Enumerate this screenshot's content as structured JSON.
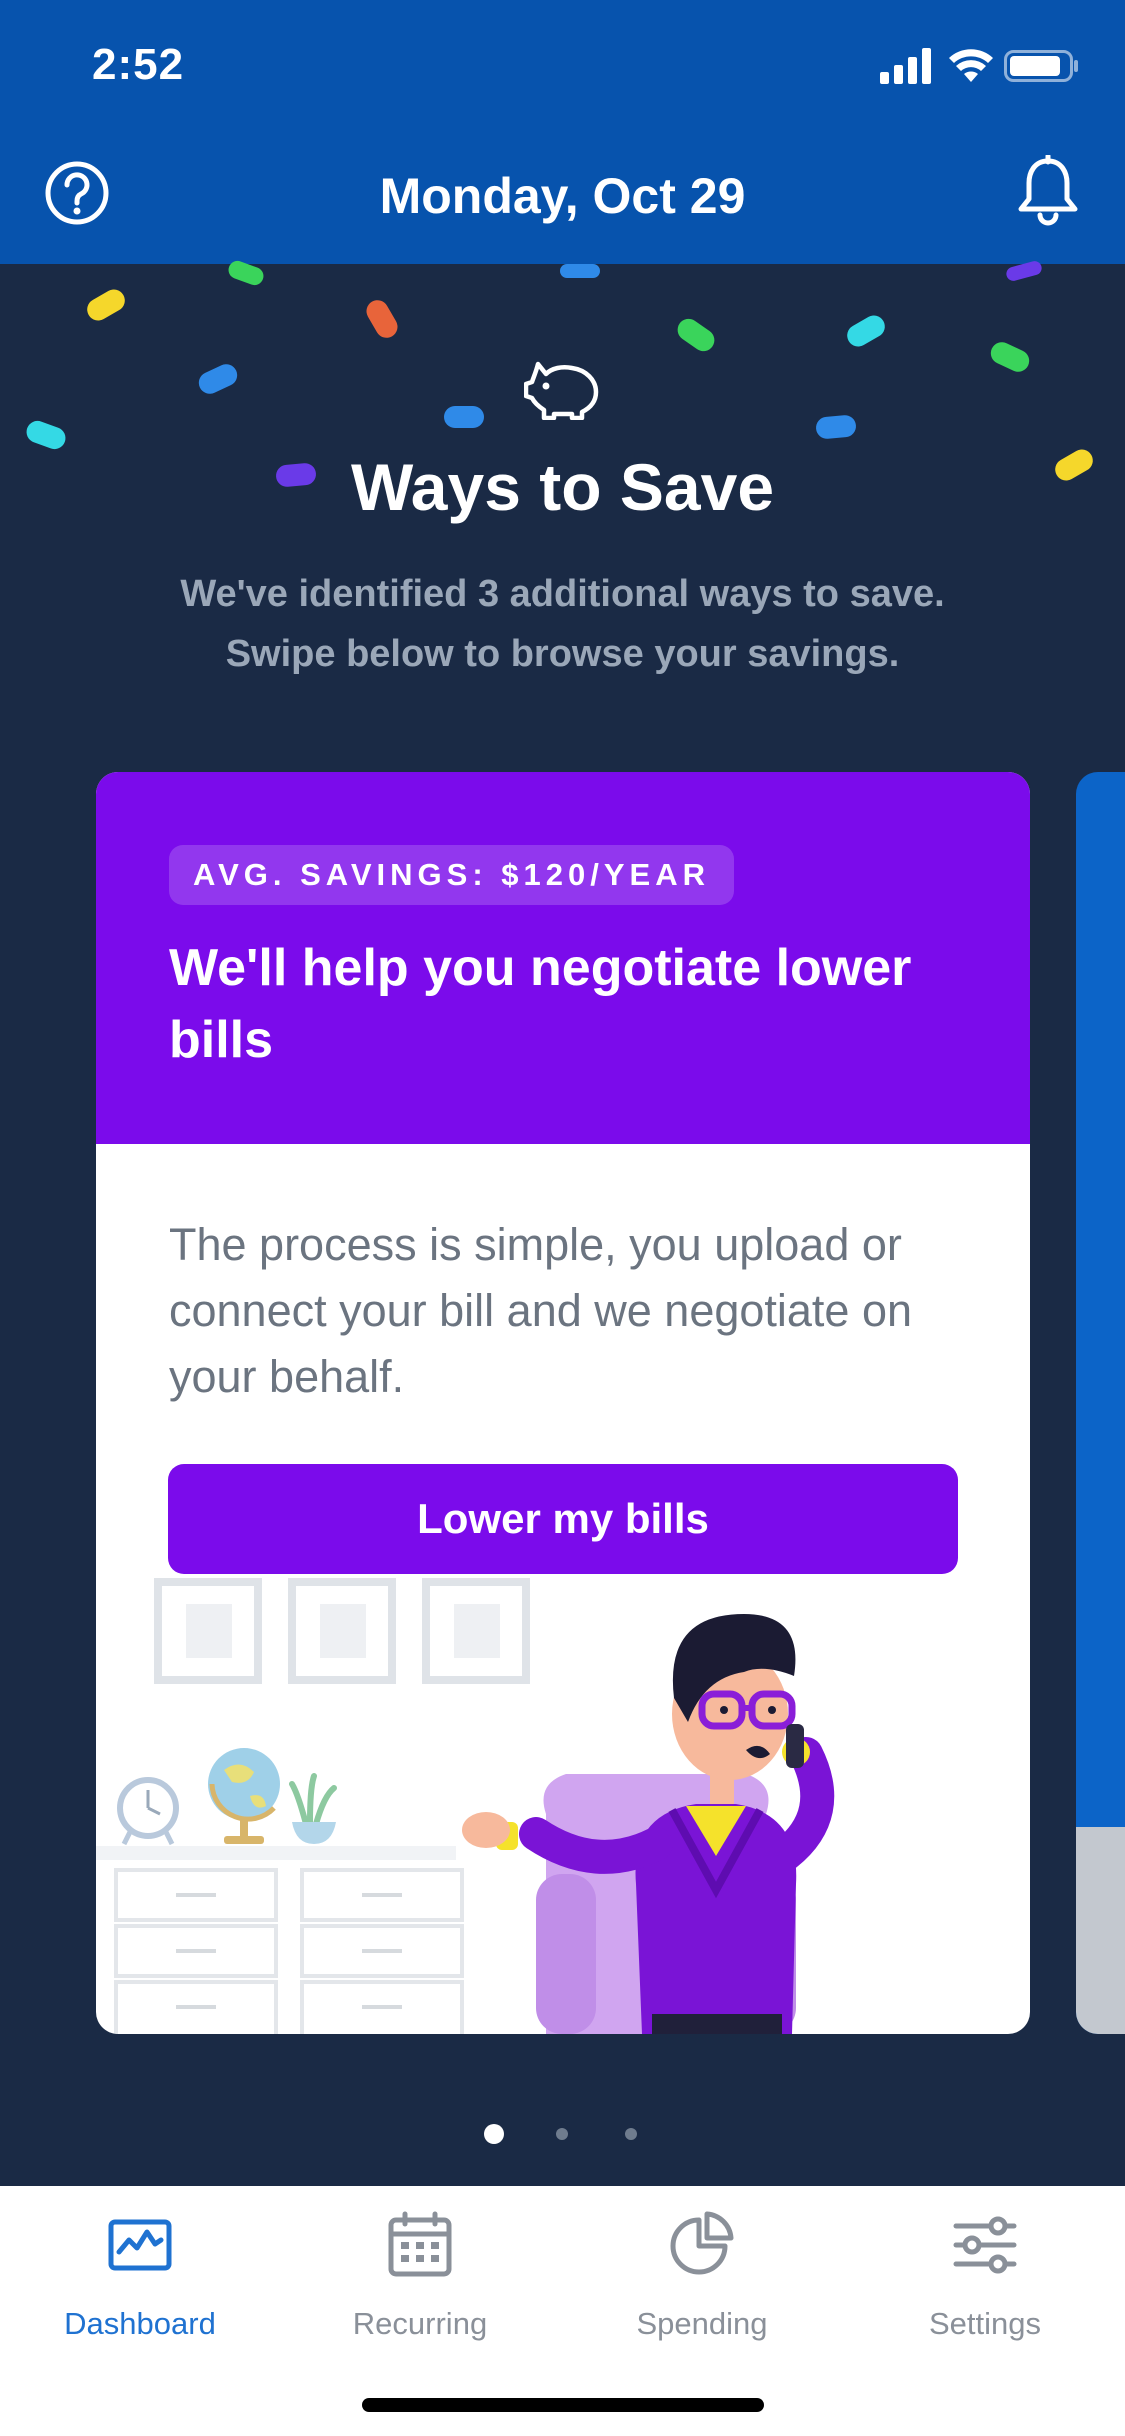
{
  "status_bar": {
    "time": "2:52"
  },
  "header": {
    "title": "Monday, Oct 29",
    "help_icon": "help-circle-icon",
    "bell_icon": "bell-icon",
    "background": "#0753ad"
  },
  "hero": {
    "icon": "piggy-bank-icon",
    "title": "Ways to Save",
    "subtitle_line1": "We've identified 3 additional ways to save.",
    "subtitle_line2": "Swipe below to browse your savings."
  },
  "card": {
    "badge": "AVG. SAVINGS: $120/YEAR",
    "title": "We'll help you negotiate lower bills",
    "description": "The process is simple, you upload or connect your bill and we negotiate on your behalf.",
    "button_label": "Lower my bills",
    "accent": "#7b0beb"
  },
  "pagination": {
    "current": 1,
    "total": 3
  },
  "tab_bar": {
    "tabs": [
      {
        "label": "Dashboard",
        "icon": "dashboard-icon",
        "active": true
      },
      {
        "label": "Recurring",
        "icon": "calendar-icon",
        "active": false
      },
      {
        "label": "Spending",
        "icon": "pie-chart-icon",
        "active": false
      },
      {
        "label": "Settings",
        "icon": "sliders-icon",
        "active": false
      }
    ],
    "active_color": "#1f72d1",
    "inactive_color": "#8a9099"
  }
}
